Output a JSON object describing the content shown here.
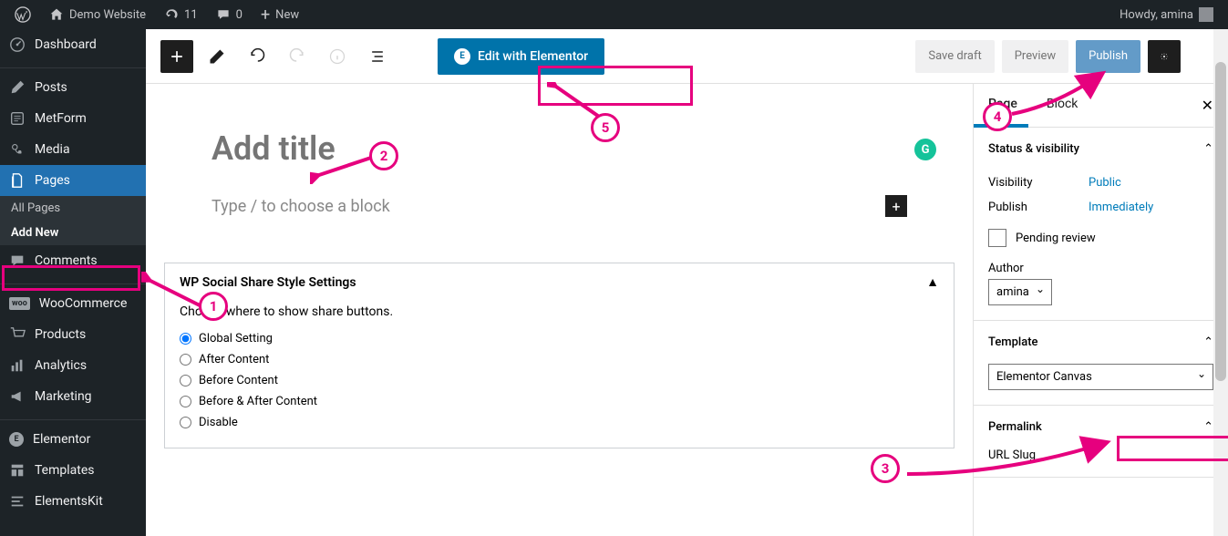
{
  "adminbar": {
    "site": "Demo Website",
    "updates": "11",
    "comments": "0",
    "new": "New",
    "howdy": "Howdy, amina"
  },
  "menu": {
    "dashboard": "Dashboard",
    "posts": "Posts",
    "metform": "MetForm",
    "media": "Media",
    "pages": "Pages",
    "all_pages": "All Pages",
    "add_new": "Add New",
    "comments": "Comments",
    "woocommerce": "WooCommerce",
    "products": "Products",
    "analytics": "Analytics",
    "marketing": "Marketing",
    "elementor": "Elementor",
    "templates": "Templates",
    "elementskit": "ElementsKit"
  },
  "editor": {
    "elementor_btn": "Edit with Elementor",
    "save_draft": "Save draft",
    "preview": "Preview",
    "publish": "Publish",
    "title_placeholder": "Add title",
    "block_placeholder": "Type / to choose a block"
  },
  "social_panel": {
    "title": "WP Social Share Style Settings",
    "desc": "Choose where to show share buttons.",
    "opts": [
      "Global Setting",
      "After Content",
      "Before Content",
      "Before & After Content",
      "Disable"
    ]
  },
  "sidebar": {
    "tab_page": "Page",
    "tab_block": "Block",
    "status_title": "Status & visibility",
    "visibility_lbl": "Visibility",
    "visibility_val": "Public",
    "publish_lbl": "Publish",
    "publish_val": "Immediately",
    "pending": "Pending review",
    "author_lbl": "Author",
    "author_val": "amina",
    "template_title": "Template",
    "template_val": "Elementor Canvas",
    "permalink_title": "Permalink",
    "slug_lbl": "URL Slug"
  },
  "annotations": [
    "1",
    "2",
    "3",
    "4",
    "5"
  ]
}
